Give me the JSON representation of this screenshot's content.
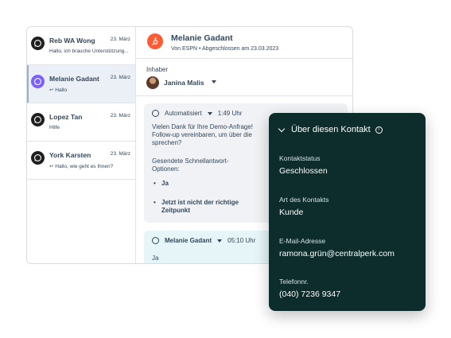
{
  "conversations": [
    {
      "name": "Reb WA Wong",
      "date": "23. März",
      "preview": "Hallo, ich brauche Unterstützung..."
    },
    {
      "name": "Melanie Gadant",
      "date": "23. März",
      "preview": "↩ Hallo"
    },
    {
      "name": "Lopez Tan",
      "date": "23. März",
      "preview": "Hilfe"
    },
    {
      "name": "York Karsten",
      "date": "23. März",
      "preview": "↩ Hallo, wie geht es Ihnen?"
    }
  ],
  "header": {
    "name": "Melanie Gadant",
    "subtitle": "Von ESPN  •  Abgeschlossen am 23.03.2023"
  },
  "owner": {
    "label": "Inhaber",
    "name": "Janina Malis"
  },
  "messages": {
    "automated": {
      "sender": "Automatisiert",
      "time": "1:49 Uhr",
      "body": "Vielen Dank für Ihre Demo-Anfrage! Follow-up vereinbaren, um über die sprechen?",
      "options_label": "Gesendete Schnellantwort-Optionen:",
      "options": [
        "Ja",
        "Jetzt ist nicht der richtige Zeitpunkt"
      ]
    },
    "reply": {
      "sender": "Melanie Gadant",
      "time": "05:10 Uhr",
      "body": "Ja"
    }
  },
  "contact_panel": {
    "title": "Über diesen Kontakt",
    "fields": [
      {
        "label": "Kontaktstatus",
        "value": "Geschlossen"
      },
      {
        "label": "Art des Kontakts",
        "value": "Kunde"
      },
      {
        "label": "E-Mail-Adresse",
        "value": "ramona.grün@centralperk.com"
      },
      {
        "label": "Telefonnr.",
        "value": "(040) 7236 9347"
      }
    ]
  },
  "colors": {
    "accent": "#ff5c35",
    "panel": "#0d2c2c",
    "active_avatar": "#7b61ff"
  }
}
